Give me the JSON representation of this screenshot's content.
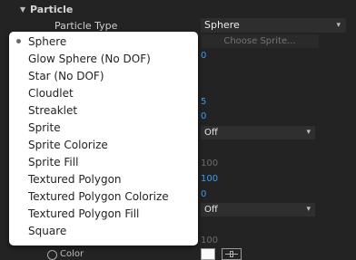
{
  "section": {
    "title": "Particle"
  },
  "particle_type": {
    "label": "Particle Type",
    "value": "Sphere"
  },
  "choose_sprite": {
    "label": "Choose Sprite..."
  },
  "numbers": {
    "n1": "0",
    "n2": "5",
    "n3": "0",
    "n4": "100",
    "n5": "100",
    "n6": "0",
    "n7": "100"
  },
  "dropdown_off_1": {
    "value": "Off"
  },
  "dropdown_off_2": {
    "value": "Off"
  },
  "color": {
    "label": "Color",
    "swatch": "#fafafa"
  },
  "menu": {
    "selected": "Sphere",
    "items": [
      "Sphere",
      "Glow Sphere (No DOF)",
      "Star (No DOF)",
      "Cloudlet",
      "Streaklet",
      "Sprite",
      "Sprite Colorize",
      "Sprite Fill",
      "Textured Polygon",
      "Textured Polygon Colorize",
      "Textured Polygon Fill",
      "Square"
    ]
  }
}
